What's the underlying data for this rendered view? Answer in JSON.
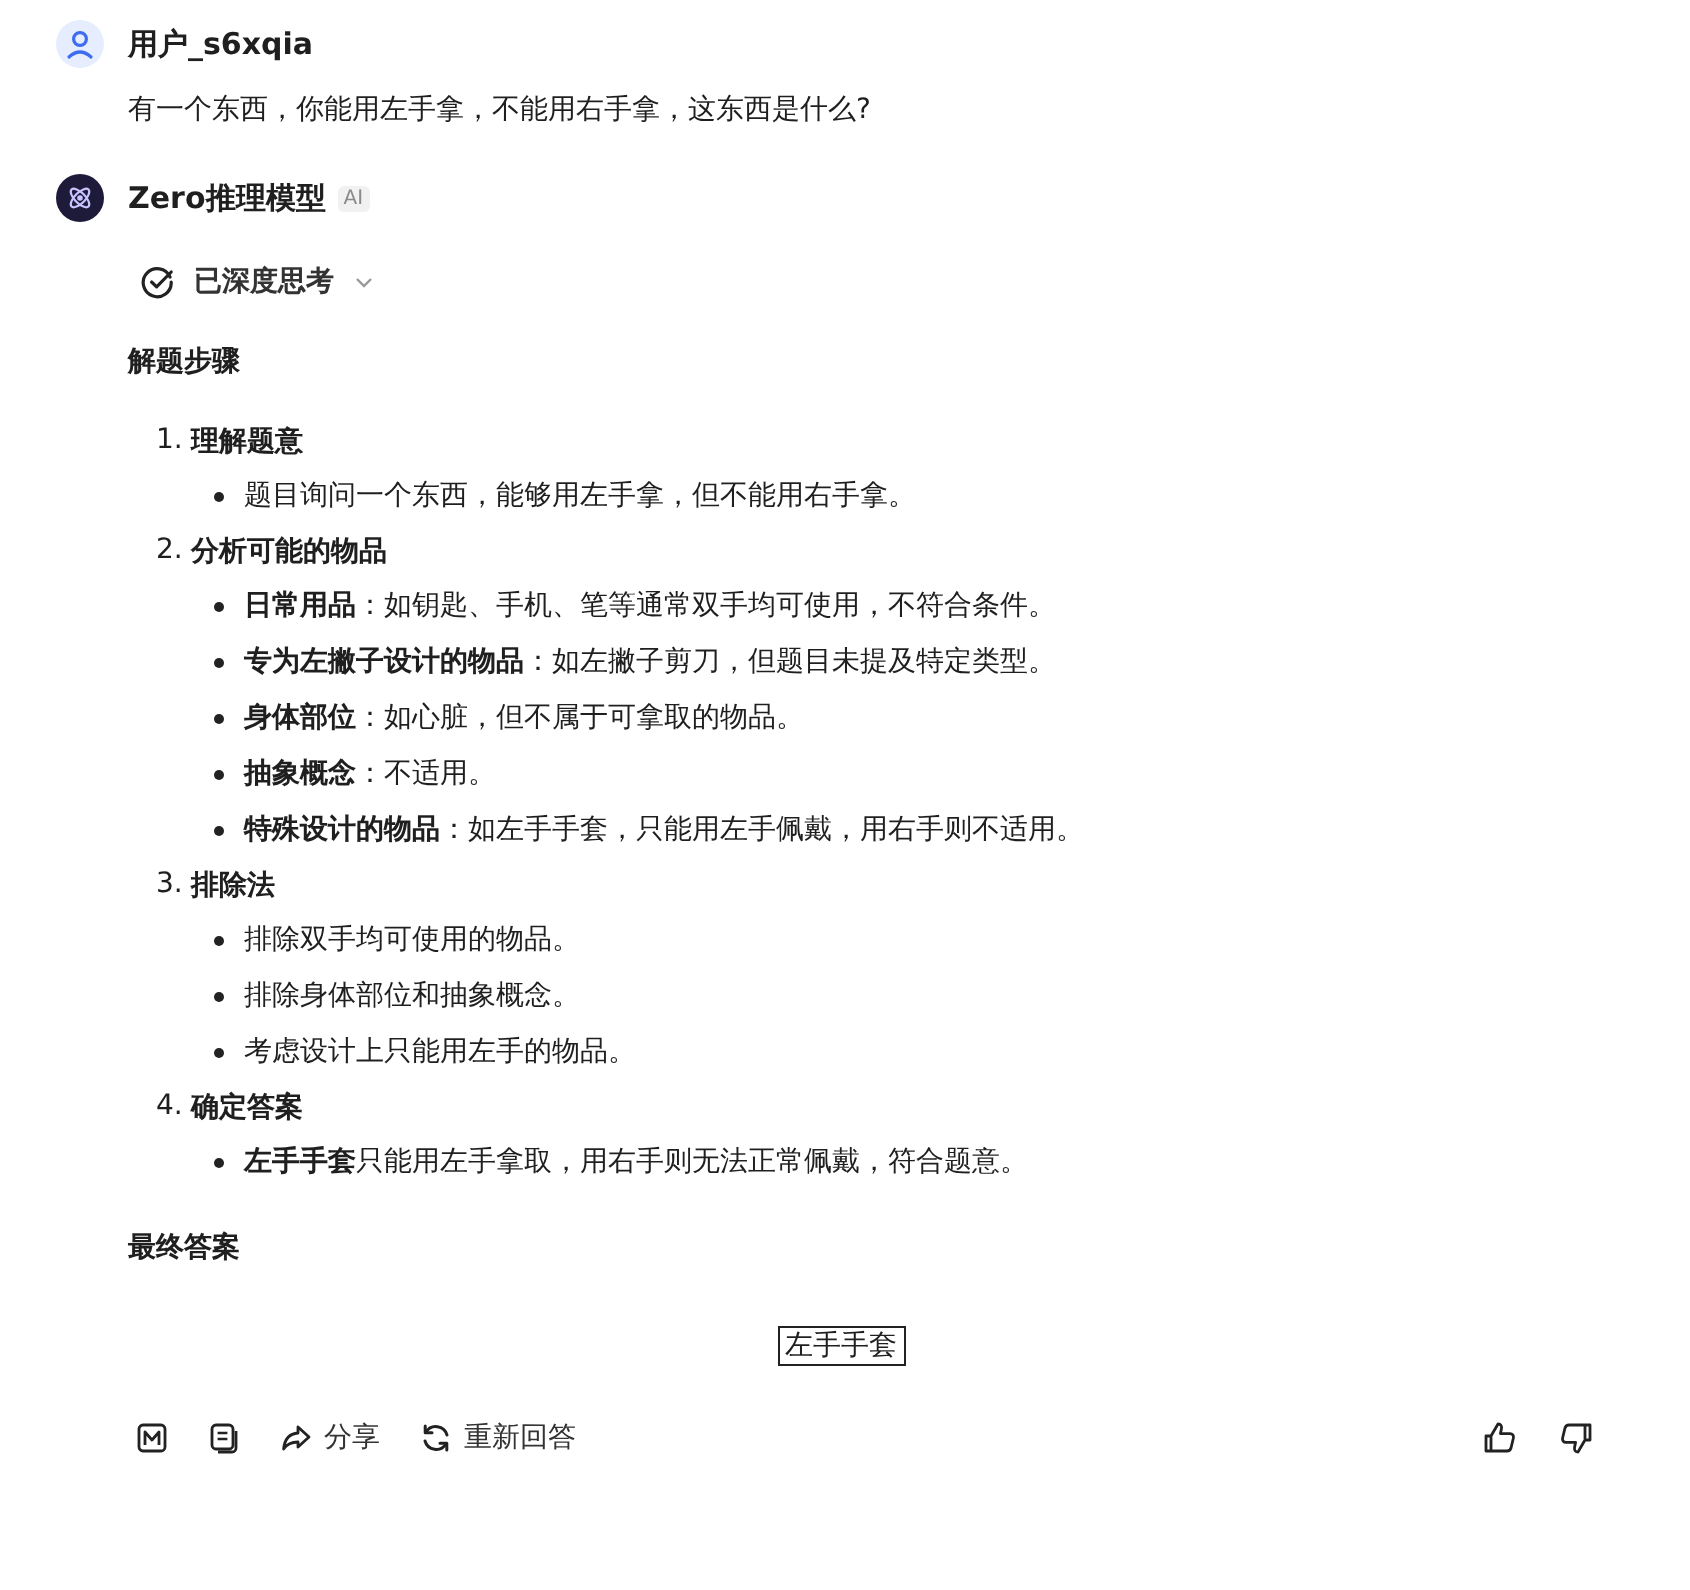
{
  "user_message": {
    "username": "用户_s6xqia",
    "text": "有一个东西，你能用左手拿，不能用右手拿，这东西是什么?"
  },
  "assistant": {
    "name": "Zero推理模型",
    "badge": "AI",
    "thinking_status": "已深度思考",
    "thinking_expanded": false
  },
  "heading": "解题步骤",
  "steps": [
    {
      "number": "1.",
      "title": "理解题意",
      "points": [
        "题目询问一个东西，能够用左手拿，但不能用右手拿。"
      ]
    },
    {
      "number": "2.",
      "title": "分析可能的物品",
      "points": [
        "**日常用品**：如钥匙、手机、笔等通常双手均可使用，不符合条件。",
        "**专为左撇子设计的物品**：如左撇子剪刀，但题目未提及特定类型。",
        "**身体部位**：如心脏，但不属于可拿取的物品。",
        "**抽象概念**：不适用。",
        "**特殊设计的物品**：如左手手套，只能用左手佩戴，用右手则不适用。"
      ]
    },
    {
      "number": "3.",
      "title": "排除法",
      "points": [
        "排除双手均可使用的物品。",
        "排除身体部位和抽象概念。",
        "考虑设计上只能用左手的物品。"
      ]
    },
    {
      "number": "4.",
      "title": "确定答案",
      "points": [
        "**左手手套**只能用左手拿取，用右手则无法正常佩戴，符合题意。"
      ]
    }
  ],
  "final_heading": "最终答案",
  "final_answer": "左手手套",
  "actions": [
    {
      "kind": "markdown"
    },
    {
      "kind": "copy"
    },
    {
      "kind": "share",
      "label": "分享"
    },
    {
      "kind": "regenerate",
      "label": "重新回答"
    }
  ],
  "feedback": [
    {
      "kind": "like"
    },
    {
      "kind": "dislike"
    }
  ]
}
